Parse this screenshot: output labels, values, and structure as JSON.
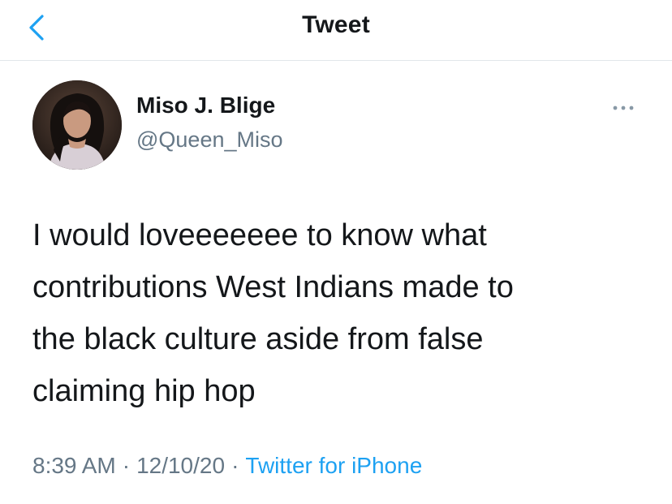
{
  "header": {
    "title": "Tweet",
    "back_icon": "chevron-left-icon",
    "accent_color": "#1da1f2"
  },
  "tweet": {
    "author": {
      "display_name": "Miso J. Blige",
      "handle": "@Queen_Miso",
      "avatar_icon": "profile-photo"
    },
    "more_icon": "more-dots-icon",
    "text_lines": [
      "I would loveeeeeee to know what",
      "contributions West Indians made to",
      "the black culture aside from false",
      "claiming hip hop"
    ],
    "meta": {
      "time": "8:39 AM",
      "separator": "·",
      "date": "12/10/20",
      "source": "Twitter for iPhone"
    }
  },
  "colors": {
    "text_primary": "#14171a",
    "text_secondary": "#657786",
    "link": "#1da1f2",
    "divider": "#e1e6ea"
  }
}
